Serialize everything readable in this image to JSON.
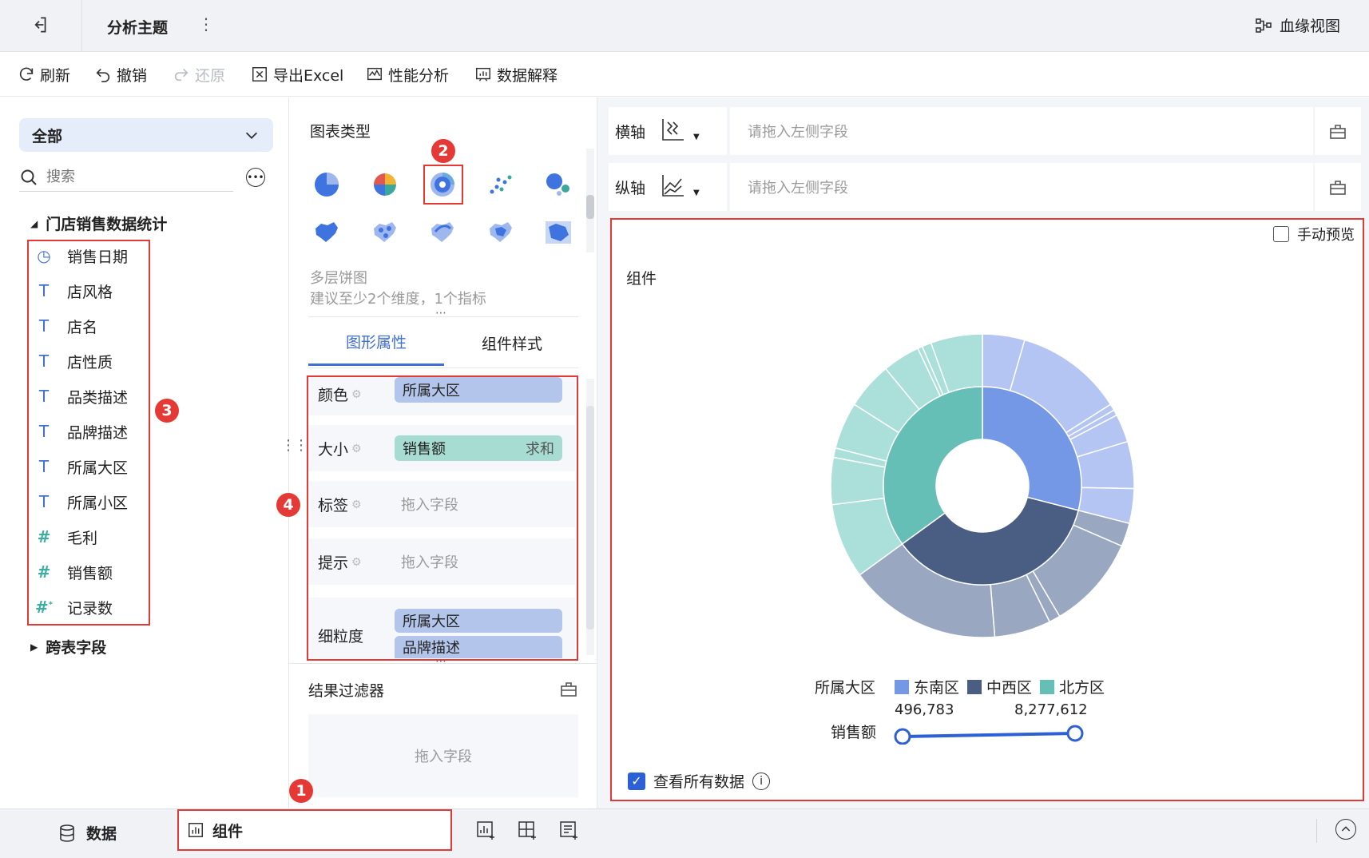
{
  "topbar": {
    "title": "分析主题",
    "lineage_label": "血缘视图"
  },
  "toolbar": {
    "refresh": "刷新",
    "undo": "撤销",
    "redo": "还原",
    "export_excel": "导出Excel",
    "performance": "性能分析",
    "data_explain": "数据解释"
  },
  "left": {
    "scope_select": "全部",
    "search_placeholder": "搜索",
    "group1": "门店销售数据统计",
    "fields": [
      {
        "label": "销售日期",
        "type": "date"
      },
      {
        "label": "店风格",
        "type": "text"
      },
      {
        "label": "店名",
        "type": "text"
      },
      {
        "label": "店性质",
        "type": "text"
      },
      {
        "label": "品类描述",
        "type": "text"
      },
      {
        "label": "品牌描述",
        "type": "text"
      },
      {
        "label": "所属大区",
        "type": "text"
      },
      {
        "label": "所属小区",
        "type": "text"
      },
      {
        "label": "毛利",
        "type": "number"
      },
      {
        "label": "销售额",
        "type": "number"
      },
      {
        "label": "记录数",
        "type": "count"
      }
    ],
    "group2": "跨表字段"
  },
  "mid": {
    "chart_type_title": "图表类型",
    "selected_chart_name": "多层饼图",
    "selected_chart_hint": "建议至少2个维度，1个指标",
    "tab_properties": "图形属性",
    "tab_style": "组件样式",
    "color_label": "颜色",
    "color_field": "所属大区",
    "size_label": "大小",
    "size_field": "销售额",
    "size_agg": "求和",
    "tag_label": "标签",
    "tag_placeholder": "拖入字段",
    "tip_label": "提示",
    "tip_placeholder": "拖入字段",
    "granularity_label": "细粒度",
    "granularity_fields": [
      "所属大区",
      "品牌描述"
    ],
    "filter_title": "结果过滤器",
    "filter_placeholder": "拖入字段"
  },
  "right": {
    "x_axis_label": "横轴",
    "y_axis_label": "纵轴",
    "x_axis_placeholder": "请拖入左侧字段",
    "y_axis_placeholder": "请拖入左侧字段",
    "manual_preview": "手动预览",
    "component_title": "组件",
    "legend_title": "所属大区",
    "legend_items": [
      {
        "name": "东南区",
        "color": "#7598e6"
      },
      {
        "name": "中西区",
        "color": "#4a5d82"
      },
      {
        "name": "北方区",
        "color": "#66bfb6"
      }
    ],
    "size_legend_title": "销售额",
    "size_min": "496,783",
    "size_max": "8,277,612",
    "view_all": "查看所有数据"
  },
  "bottom": {
    "data_tab": "数据",
    "component_tab": "组件"
  },
  "annotations": [
    "1",
    "2",
    "3",
    "4"
  ],
  "chart_data": {
    "type": "pie",
    "subtype": "multi-level",
    "inner_ring": [
      {
        "name": "东南区",
        "value": 0.29
      },
      {
        "name": "中西区",
        "value": 0.36
      },
      {
        "name": "北方区",
        "value": 0.35
      }
    ],
    "outer_ring": [
      {
        "parent": "东南区",
        "value": 0.045
      },
      {
        "parent": "东南区",
        "value": 0.115
      },
      {
        "parent": "东南区",
        "value": 0.007
      },
      {
        "parent": "东南区",
        "value": 0.006
      },
      {
        "parent": "东南区",
        "value": 0.03
      },
      {
        "parent": "东南区",
        "value": 0.05
      },
      {
        "parent": "东南区",
        "value": 0.037
      },
      {
        "parent": "中西区",
        "value": 0.025
      },
      {
        "parent": "中西区",
        "value": 0.1
      },
      {
        "parent": "中西区",
        "value": 0.012
      },
      {
        "parent": "中西区",
        "value": 0.06
      },
      {
        "parent": "中西区",
        "value": 0.163
      },
      {
        "parent": "北方区",
        "value": 0.08
      },
      {
        "parent": "北方区",
        "value": 0.05
      },
      {
        "parent": "北方区",
        "value": 0.01
      },
      {
        "parent": "北方区",
        "value": 0.05
      },
      {
        "parent": "北方区",
        "value": 0.05
      },
      {
        "parent": "北方区",
        "value": 0.04
      },
      {
        "parent": "北方区",
        "value": 0.005
      },
      {
        "parent": "北方区",
        "value": 0.01
      },
      {
        "parent": "北方区",
        "value": 0.055
      }
    ],
    "legend": [
      "东南区",
      "中西区",
      "北方区"
    ],
    "size_range": [
      "496,783",
      "8,277,612"
    ]
  }
}
